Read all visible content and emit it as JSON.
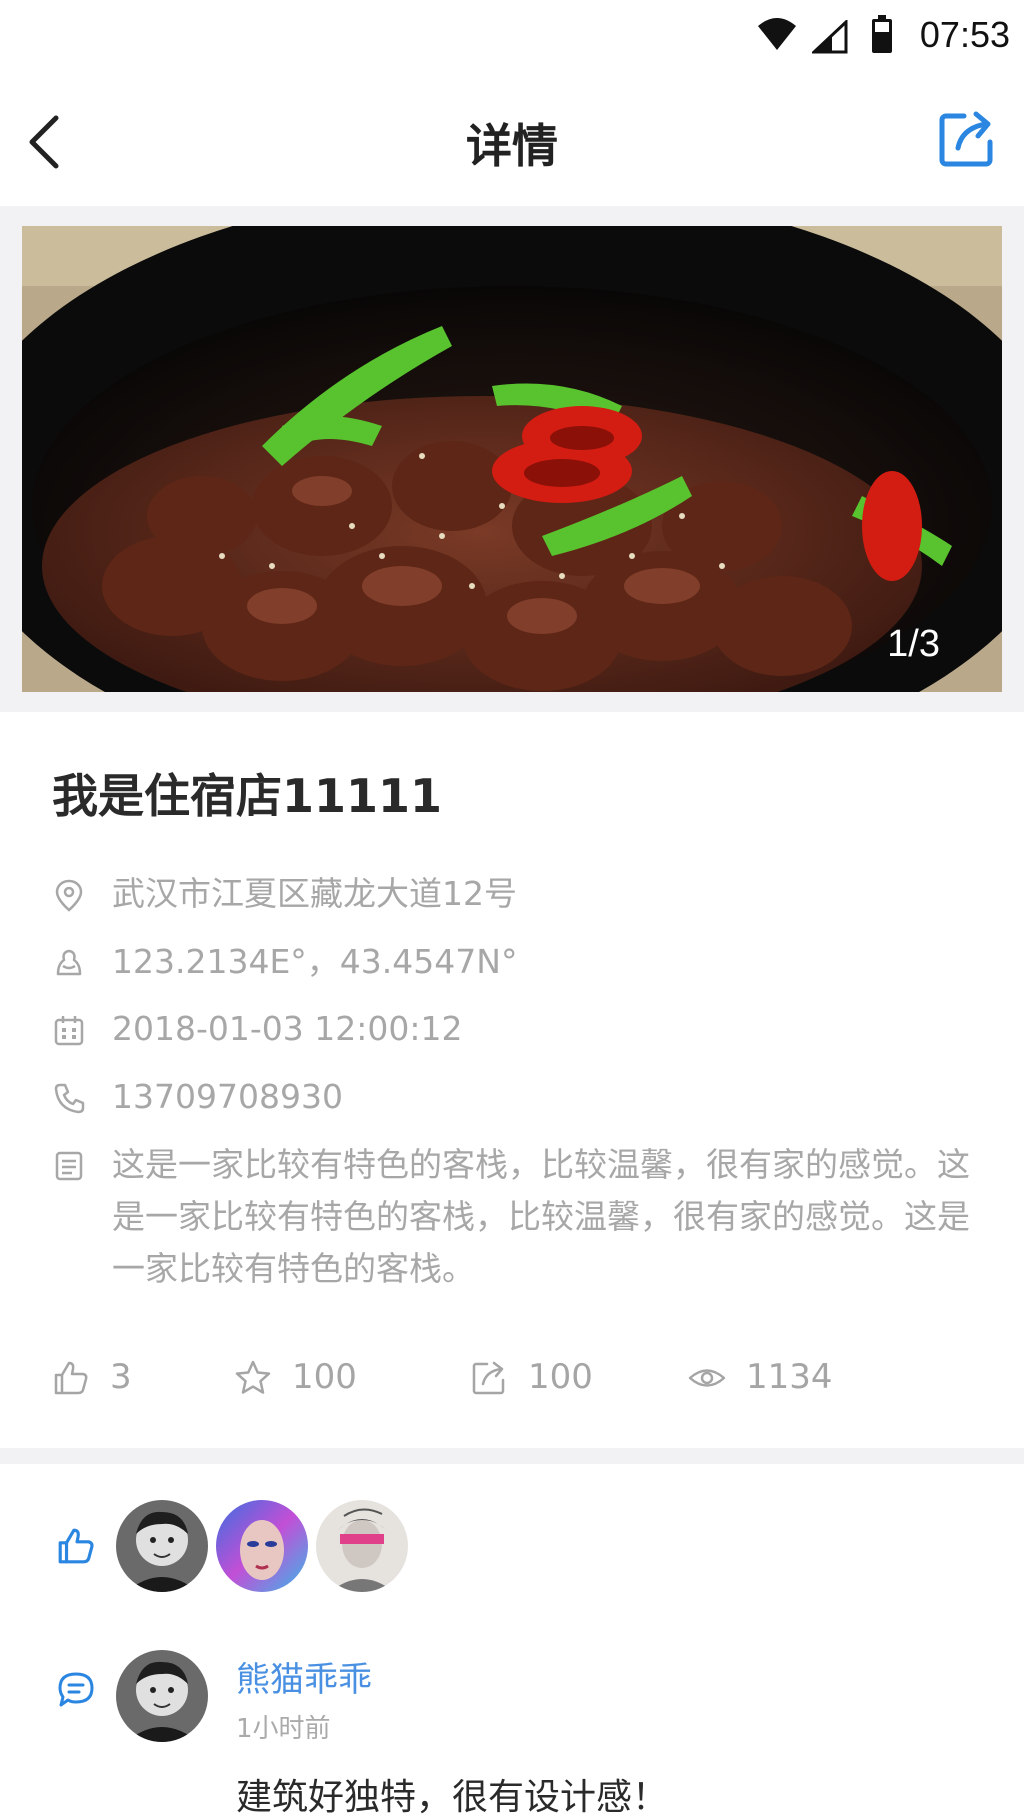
{
  "status_bar": {
    "time": "07:53"
  },
  "nav": {
    "title": "详情"
  },
  "gallery": {
    "pager": "1/3"
  },
  "shop": {
    "title": "我是住宿店11111",
    "address": "武汉市江夏区藏龙大道12号",
    "coordinates": "123.2134E°，43.4547N°",
    "datetime": "2018-01-03  12:00:12",
    "phone": "13709708930",
    "description": "这是一家比较有特色的客栈，比较温馨，很有家的感觉。这是一家比较有特色的客栈，比较温馨，很有家的感觉。这是一家比较有特色的客栈。"
  },
  "stats": {
    "likes": "3",
    "favorites": "100",
    "shares": "100",
    "views": "1134"
  },
  "comment": {
    "author": "熊猫乖乖",
    "time": "1小时前",
    "text": "建筑好独特，很有设计感！"
  },
  "colors": {
    "accent": "#2a86e0",
    "muted": "#a7a7a7",
    "link": "#4a90e2"
  }
}
